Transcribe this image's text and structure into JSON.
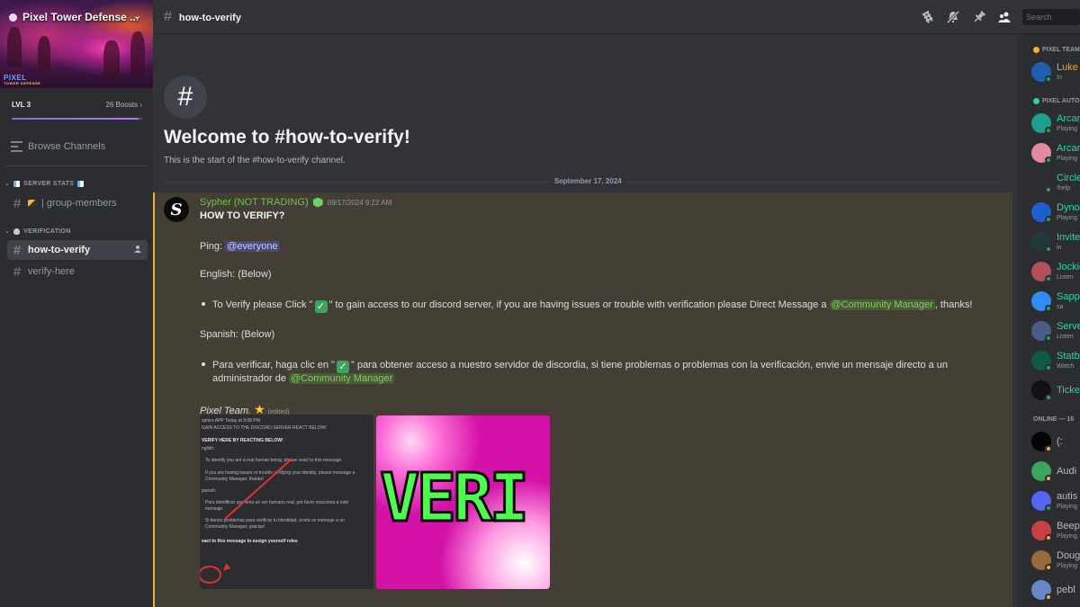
{
  "server": {
    "name": "Pixel Tower Defense ...",
    "banner_logo": "PIXEL",
    "banner_logo_sub": "TOWER DEFENSE",
    "level": "LVL 3",
    "boosts": "26 Boosts",
    "boost_progress": 0.97
  },
  "sidebar": {
    "browse_channels": "Browse Channels",
    "categories": [
      {
        "name": "SERVER STATS",
        "channels": [
          {
            "name": "| group-members"
          }
        ]
      },
      {
        "name": "VERIFICATION",
        "channels": [
          {
            "name": "how-to-verify",
            "active": true
          },
          {
            "name": "verify-here",
            "active": false
          }
        ]
      }
    ]
  },
  "topbar": {
    "channel": "how-to-verify",
    "icons": [
      "threads-icon",
      "mute-bell-icon",
      "pin-icon",
      "member-list-icon"
    ],
    "search_placeholder": "Search"
  },
  "main": {
    "welcome_title": "Welcome to #how-to-verify!",
    "welcome_sub": "This is the start of the #how-to-verify channel.",
    "date_separator": "September 17, 2024"
  },
  "message": {
    "author": "Sypher (NOT TRADING)",
    "timestamp": "09/17/2024 9:22 AM",
    "heading": "HOW TO VERIFY?",
    "ping_label": "Ping:",
    "ping_mention": "@everyone",
    "english_label": "English: (Below)",
    "english_a": "To Verify please Click \"",
    "english_b": "\" to gain access to our discord server, if you are having issues or trouble with verification please Direct Message a",
    "english_mention": "@Community Manager",
    "english_c": ", thanks!",
    "spanish_label": "Spanish: (Below)",
    "spanish_a": "Para verificar, haga clic en \"",
    "spanish_b": "\" para obtener acceso a nuestro servidor de discordia, si tiene problemas o problemas con la verificación, envie un mensaje directo a un",
    "spanish_c": "administrador de",
    "spanish_mention": "@Community Manager",
    "signature": "Pixel Team.",
    "edited": "(edited)",
    "check_emoji": "✓",
    "star_emoji": "★",
    "screenshot_lines": [
      "sphire  APP  Today at 9:08 PM",
      "GAIN ACCESS TO THE DISCORD SERVER REACT BELOW!",
      "VERIFY HERE BY REACTING BELOW!",
      "nglish:",
      "To identify you are a real human being, please react to this message.",
      "If you are having issues or trouble verifying your identity, please message a",
      "Community Manager, thanks!",
      "panish:",
      "Para identificar que eres un ser humano real, por favor reacciona a este",
      "mensaje.",
      "Si tienes problemas para verificar tu identidad, envía un mensaje a un",
      "Community Manager, gracias!",
      "eact to this message to assign yourself roles"
    ],
    "gif_text": "VERI"
  },
  "members": {
    "groups": [
      {
        "name": "PIXEL TEAM",
        "color": "#f0b232",
        "items": [
          {
            "name": "Luke",
            "sub": "In",
            "color": "#f0a030",
            "avatar": "#1f5fb0",
            "status": "#23a55a"
          }
        ]
      },
      {
        "name": "PIXEL AUTOMATION",
        "color": "#2dd4a8",
        "items": [
          {
            "name": "Arcane",
            "sub": "Playing",
            "color": "#2dd4a8",
            "avatar": "#1e9e8c",
            "status": "#23a55a"
          },
          {
            "name": "Arcane",
            "sub": "Playing",
            "color": "#2dd4a8",
            "avatar": "#e48aa0",
            "status": "#23a55a"
          },
          {
            "name": "Circle",
            "sub": "!help",
            "color": "#2dd4a8",
            "avatar": "#2b2d31",
            "status": "#23a55a"
          },
          {
            "name": "Dyno",
            "sub": "Playing",
            "color": "#2dd4a8",
            "avatar": "#1d5fd0",
            "status": "#23a55a"
          },
          {
            "name": "Invite",
            "sub": "in",
            "color": "#2dd4a8",
            "avatar": "#1f3a38",
            "status": "#23a55a"
          },
          {
            "name": "Jockie",
            "sub": "Listen",
            "color": "#2dd4a8",
            "avatar": "#b5505a",
            "status": "#23a55a"
          },
          {
            "name": "Sapphire",
            "sub": "sa",
            "color": "#2dd4a8",
            "avatar": "#2f8ef2",
            "status": "#23a55a"
          },
          {
            "name": "Server",
            "sub": "Listen",
            "color": "#2dd4a8",
            "avatar": "#4e5d88",
            "status": "#23a55a"
          },
          {
            "name": "Statbot",
            "sub": "Watch",
            "color": "#2dd4a8",
            "avatar": "#0f5a45",
            "status": "#23a55a"
          },
          {
            "name": "Ticket",
            "sub": "",
            "color": "#2dd4a8",
            "avatar": "#111214",
            "status": "#23a55a"
          }
        ]
      },
      {
        "name": "ONLINE — 16",
        "color": "",
        "items": [
          {
            "name": "(:",
            "sub": "",
            "color": "#b5bac1",
            "avatar": "#050505",
            "status": "#f0b232"
          },
          {
            "name": "Audi",
            "sub": "",
            "color": "#b5bac1",
            "avatar": "#3ba55c",
            "status": "#f0b232"
          },
          {
            "name": "autis",
            "sub": "Playing",
            "color": "#b5bac1",
            "avatar": "#5865f2",
            "status": "#23a55a"
          },
          {
            "name": "Beep",
            "sub": "Playing",
            "color": "#b5bac1",
            "avatar": "#c84040",
            "status": "#f0b232"
          },
          {
            "name": "Doug",
            "sub": "Playing",
            "color": "#b5bac1",
            "avatar": "#9a6a3a",
            "status": "#f0b232"
          },
          {
            "name": "pebl",
            "sub": "",
            "color": "#b5bac1",
            "avatar": "#6a86c8",
            "status": "#f0b232"
          }
        ]
      }
    ]
  }
}
